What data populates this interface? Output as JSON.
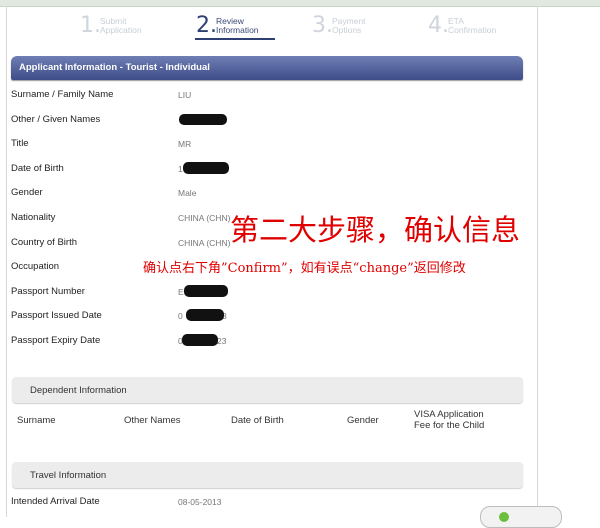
{
  "steps": [
    {
      "num": "1.",
      "line1": "Submit",
      "line2": "Application",
      "active": false
    },
    {
      "num": "2.",
      "line1": "Review",
      "line2": "Information",
      "active": true
    },
    {
      "num": "3.",
      "line1": "Payment",
      "line2": "Options",
      "active": false
    },
    {
      "num": "4.",
      "line1": "ETA",
      "line2": "Confirmation",
      "active": false
    }
  ],
  "applicant": {
    "header": "Applicant Information - Tourist - Individual",
    "rows": [
      {
        "label": "Surname / Family Name",
        "value": "LIU"
      },
      {
        "label": "Other / Given Names",
        "value": ""
      },
      {
        "label": "Title",
        "value": "MR"
      },
      {
        "label": "Date of Birth",
        "value": "1"
      },
      {
        "label": "Gender",
        "value": "Male"
      },
      {
        "label": "Nationality",
        "value": "CHINA (CHN)"
      },
      {
        "label": "Country of Birth",
        "value": "CHINA (CHN)"
      },
      {
        "label": "Occupation",
        "value": ""
      },
      {
        "label": "Passport Number",
        "value": "E"
      },
      {
        "label": "Passport Issued Date",
        "value": "0"
      },
      {
        "label": "Passport Expiry Date",
        "value": "0"
      }
    ],
    "issued_suffix": "3",
    "expiry_suffix": "23"
  },
  "dependent": {
    "header": "Dependent Information",
    "columns": [
      "Surname",
      "Other Names",
      "Date of Birth",
      "Gender",
      "VISA Application",
      "Fee for the Child"
    ]
  },
  "travel": {
    "header": "Travel Information",
    "rows": [
      {
        "label": "Intended Arrival Date",
        "value": "08-05-2013"
      }
    ]
  },
  "annotation": {
    "big": "第二大步骤，确认信息",
    "small": "确认点右下角”Confirm”，如有误点“change”返回修改"
  },
  "colors": {
    "header_bar": "#3e4d8a",
    "annotation": "#e00000",
    "active_step": "#2e3f73"
  }
}
